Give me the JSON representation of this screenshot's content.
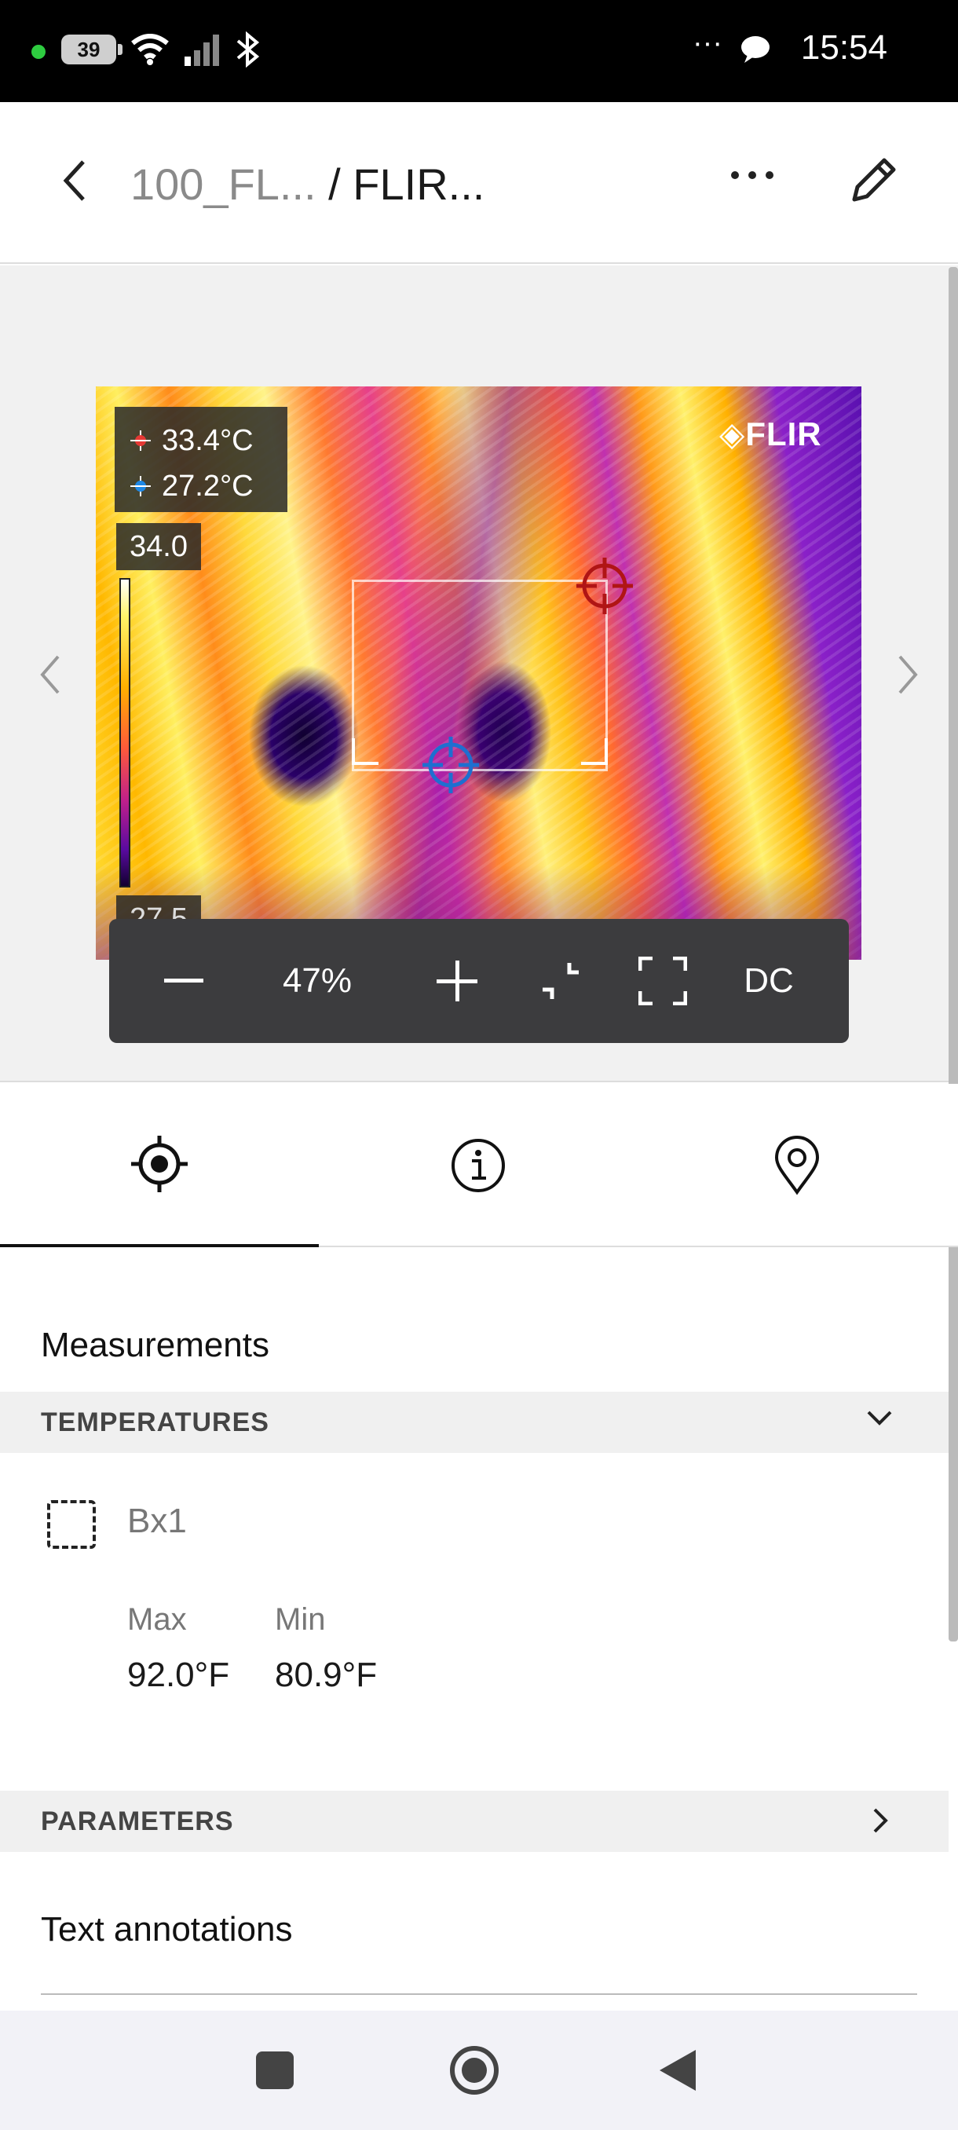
{
  "status_bar": {
    "battery": "39",
    "time": "15:54",
    "overflow": "···"
  },
  "header": {
    "breadcrumb_parent": "100_FL...",
    "breadcrumb_sep": "/",
    "breadcrumb_current": "FLIR..."
  },
  "image": {
    "spot_max": "33.4°C",
    "spot_min": "27.2°C",
    "scale_max": "34.0",
    "scale_min": "27.5",
    "logo": "FLIR"
  },
  "zoom": {
    "minus": "—",
    "level": "47%",
    "plus": "+",
    "dc": "DC"
  },
  "tabs": [
    {
      "icon": "crosshair-icon"
    },
    {
      "icon": "info-icon"
    },
    {
      "icon": "location-pin-icon"
    }
  ],
  "measurements": {
    "title": "Measurements",
    "temperatures_header": "TEMPERATURES",
    "item_label": "Bx1",
    "max_label": "Max",
    "max_value": "92.0°F",
    "min_label": "Min",
    "min_value": "80.9°F"
  },
  "parameters_header": "PARAMETERS",
  "text_annotations": "Text annotations",
  "colors": {
    "max_spot": "#e53935",
    "min_spot": "#1e88e5"
  }
}
